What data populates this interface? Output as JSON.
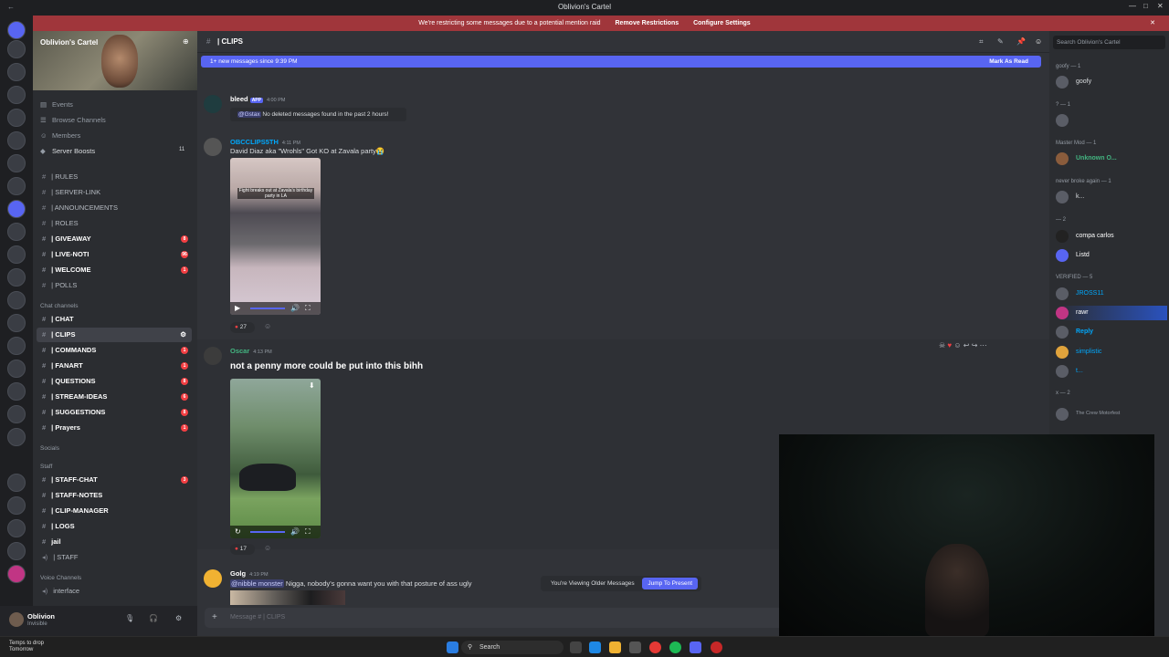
{
  "window": {
    "title": "Oblivion's Cartel"
  },
  "notice": {
    "text": "We're restricting some messages due to a potential mention raid",
    "remove": "Remove Restrictions",
    "configure": "Configure Settings"
  },
  "server": {
    "name": "Oblivion's Cartel"
  },
  "nav": {
    "events": "Events",
    "browse": "Browse Channels",
    "members": "Members",
    "boosts": "Server Boosts",
    "boosts_count": "11"
  },
  "channels": [
    {
      "label": "| RULES",
      "badge": ""
    },
    {
      "label": "| SERVER-LINK",
      "badge": ""
    },
    {
      "label": "| ANNOUNCEMENTS",
      "badge": ""
    },
    {
      "label": "| ROLES",
      "badge": ""
    },
    {
      "label": "| GIVEAWAY",
      "badge": "8"
    },
    {
      "label": "| LIVE-NOTI",
      "badge": "96"
    },
    {
      "label": "| WELCOME",
      "badge": "1"
    },
    {
      "label": "| POLLS",
      "badge": ""
    }
  ],
  "cat_chat": "Chat channels",
  "chat_channels": [
    {
      "label": "| CHAT",
      "badge": ""
    },
    {
      "label": "| CLIPS",
      "badge": ""
    },
    {
      "label": "| COMMANDS",
      "badge": "1"
    },
    {
      "label": "| FANART",
      "badge": "1"
    },
    {
      "label": "| QUESTIONS",
      "badge": "8"
    },
    {
      "label": "| STREAM-IDEAS",
      "badge": "6"
    },
    {
      "label": "| SUGGESTIONS",
      "badge": "8"
    },
    {
      "label": "| Prayers",
      "badge": "1"
    }
  ],
  "cat_socials": "Socials",
  "cat_staff": "Staff",
  "staff_channels": [
    {
      "label": "| STAFF-CHAT",
      "badge": "3"
    },
    {
      "label": "| STAFF-NOTES",
      "badge": ""
    },
    {
      "label": "| CLIP-MANAGER",
      "badge": ""
    },
    {
      "label": "| LOGS",
      "badge": ""
    },
    {
      "label": "jail",
      "badge": ""
    },
    {
      "label": "| STAFF",
      "badge": ""
    }
  ],
  "cat_voice": "Voice Channels",
  "voice_channel": "interface",
  "user": {
    "name": "Oblivion",
    "status": "Invisible"
  },
  "header": {
    "channel": "| CLIPS",
    "search_placeholder": "Search Oblivion's Cartel"
  },
  "newbar": {
    "text": "1+ new messages since 9:39 PM",
    "action": "Mark As Read"
  },
  "messages": [
    {
      "author": "bleed",
      "tag": "APP",
      "time": "4:00 PM",
      "embed_mention": "@Gstax",
      "embed_text": "No deleted messages found in the past 2 hours!"
    },
    {
      "author": "OBCCLIPS5TH",
      "time": "4:11 PM",
      "text": "David Diaz aka \"Wrohls\" Got KO at Zavala party😭",
      "video_caption": "Fight breaks out at Zavala's birthday party in LA",
      "reaction_count": "27"
    },
    {
      "author": "Oscar",
      "time": "4:13 PM",
      "text": "not a penny more could be put into this bihh",
      "reaction_count": "17"
    },
    {
      "author": "Golg",
      "time": "4:19 PM",
      "mention": "@nibble monster",
      "text": "Nigga, nobody's gonna want you with that  posture of ass ugly"
    }
  ],
  "jump": {
    "text": "You're Viewing Older Messages",
    "button": "Jump To Present"
  },
  "composer": {
    "placeholder": "Message # | CLIPS"
  },
  "members": {
    "groups": [
      {
        "label": "goofy — 1",
        "members": [
          "goofy"
        ]
      },
      {
        "label": "? — 1",
        "members": [
          ""
        ]
      },
      {
        "label": "Master Mod — 1",
        "members": [
          "Unknown O..."
        ]
      },
      {
        "label": "never broke again — 1",
        "members": [
          "k..."
        ]
      },
      {
        "label": "— 2",
        "members": [
          "compa carlos",
          "Listd"
        ]
      },
      {
        "label": "VERIFIED — 5",
        "members": [
          "JROSS11",
          "rawr",
          "Reply",
          "simplistic",
          "t..."
        ]
      },
      {
        "label": "x — 2",
        "members": [
          "The Crew Motorfest"
        ]
      }
    ]
  },
  "taskbar": {
    "weather": "Temps to drop",
    "weather2": "Tomorrow",
    "search": "Search"
  },
  "colors": {
    "accent": "#5865f2",
    "notice": "#a0363b",
    "unread": "#f23f43"
  }
}
